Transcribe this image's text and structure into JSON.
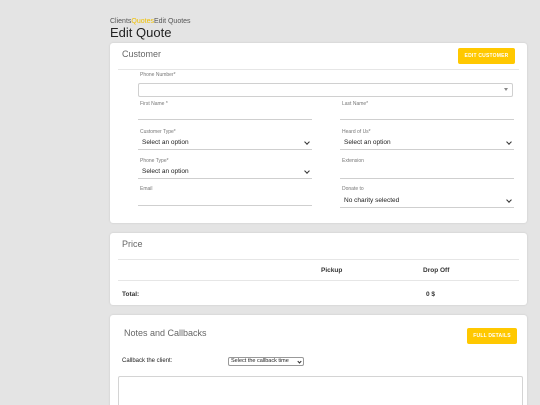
{
  "breadcrumb": {
    "clients": "Clients",
    "quotes": "Quotes",
    "current": "Edit Quotes"
  },
  "page_title": "Edit Quote",
  "customer": {
    "title": "Customer",
    "edit_button": "EDIT CUSTOMER",
    "phone_label": "Phone Number*",
    "phone_value": "",
    "first_name_label": "First Name *",
    "last_name_label": "Last Name*",
    "customer_type_label": "Customer Type*",
    "customer_type_value": "Select an option",
    "heard_of_us_label": "Heard of Us*",
    "heard_of_us_value": "Select an option",
    "phone_type_label": "Phone Type*",
    "phone_type_value": "Select an option",
    "extension_label": "Extension",
    "email_label": "Email",
    "donate_label": "Donate to",
    "donate_value": "No charity selected"
  },
  "price": {
    "title": "Price",
    "col_pickup": "Pickup",
    "col_dropoff": "Drop Off",
    "total_label": "Total:",
    "total_value": "0 $"
  },
  "notes": {
    "title": "Notes and Callbacks",
    "full_details_button": "FULL DETAILS",
    "callback_label": "Callback the client:",
    "callback_select": "Select the callback time"
  },
  "colors": {
    "accent": "#ffc800",
    "background": "#e4e4e4"
  }
}
